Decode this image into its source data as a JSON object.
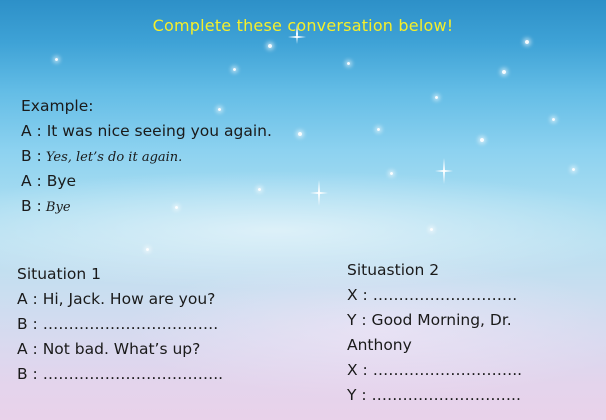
{
  "title": "Complete these conversation  below!",
  "example": {
    "heading": "Example:",
    "lines": [
      {
        "speaker": "A :",
        "text": " It was nice seeing you again."
      },
      {
        "speaker": "B :",
        "text": " Yes, let’s do it again."
      },
      {
        "speaker": "A :",
        "text": " Bye"
      },
      {
        "speaker": "B :",
        "text": " Bye"
      }
    ]
  },
  "situation1": {
    "heading": "Situation 1",
    "lines": [
      {
        "speaker": "A :",
        "text": " Hi, Jack. How are you?"
      },
      {
        "speaker": "B :",
        "text": " ……………………………."
      },
      {
        "speaker": "A :",
        "text": " Not bad. What’s up?"
      },
      {
        "speaker": "B :",
        "text": " …………………………….."
      }
    ]
  },
  "situation2": {
    "heading": "Situastion 2",
    "lines": [
      {
        "speaker": "X :",
        "text": " ………………………."
      },
      {
        "speaker": "Y :",
        "text": " Good Morning, Dr."
      },
      {
        "speaker": "",
        "text": "Anthony"
      },
      {
        "speaker": "X :",
        "text": " ……………………….."
      },
      {
        "speaker": "Y :",
        "text": " ……………………….."
      }
    ]
  },
  "colors": {
    "title": "#f6ef2a",
    "text": "#1a1a1a",
    "sky_top": "#2d90c8",
    "sky_bottom": "#e9d2ea"
  }
}
